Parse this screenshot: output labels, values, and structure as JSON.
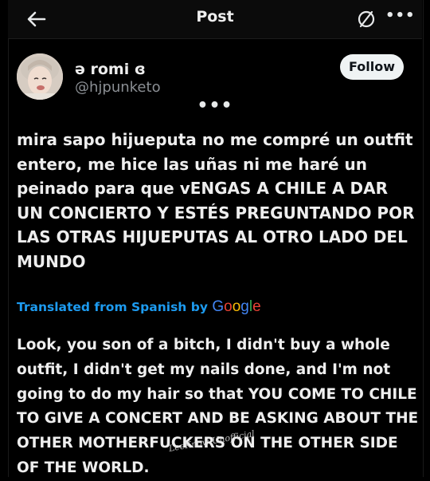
{
  "header": {
    "title": "Post",
    "more_label": "•••"
  },
  "author": {
    "display_name": "ə romi ɞ",
    "handle": "@hjpunketo",
    "follow_label": "Follow"
  },
  "post": {
    "overflow_label": "•••",
    "text": "mira sapo hijueputa no me compré un outfit entero, me hice las uñas ni me haré un peinado para que vENGAS A CHILE A DAR UN CONCIERTO Y ESTÉS PREGUNTANDO POR LAS OTRAS HIJUEPUTAS AL OTRO LADO DEL MUNDO"
  },
  "translation": {
    "label": "Translated from Spanish by",
    "provider": "Google",
    "text": "Look, you son of a bitch, I didn't buy a whole outfit, I didn't get my nails done, and I'm not going to do my hair so that YOU COME TO CHILE TO GIVE A CONCERT AND BE ASKING ABOUT THE OTHER MOTHERFUCKERS ON THE OTHER SIDE OF THE WORLD."
  },
  "watermark": "LeeKnow Unofficial",
  "colors": {
    "background": "#000000",
    "text": "#eeeeee",
    "secondary_text": "#8b8f94",
    "link": "#1d9bf0",
    "follow_bg": "#eff3f4"
  },
  "icons": [
    "back-arrow-icon",
    "no-translate-icon",
    "more-icon",
    "avatar"
  ]
}
